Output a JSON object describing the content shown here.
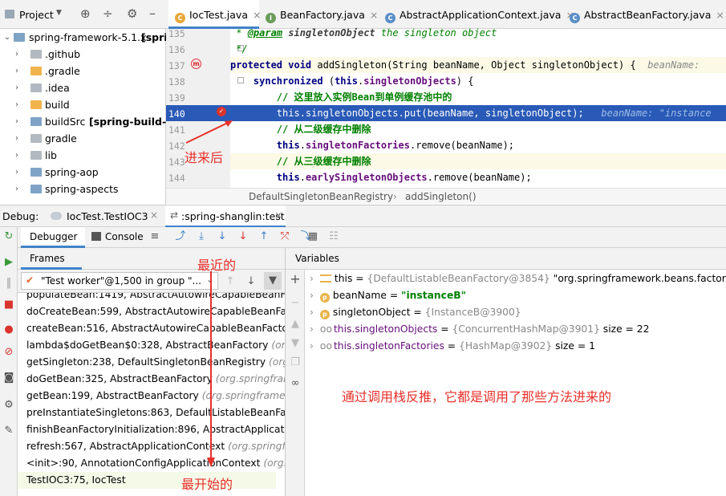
{
  "project": {
    "title": "Project",
    "root": "spring-framework-5.1.x",
    "root_module": "[spri",
    "items": [
      {
        "label": ".github",
        "module": "",
        "color": "grey"
      },
      {
        "label": ".gradle",
        "module": "",
        "color": "orange"
      },
      {
        "label": ".idea",
        "module": "",
        "color": "grey"
      },
      {
        "label": "build",
        "module": "",
        "color": "orange"
      },
      {
        "label": "buildSrc",
        "module": "[spring-build-src",
        "color": "blue"
      },
      {
        "label": "gradle",
        "module": "",
        "color": "grey"
      },
      {
        "label": "lib",
        "module": "",
        "color": "grey"
      },
      {
        "label": "spring-aop",
        "module": "",
        "color": "blue"
      },
      {
        "label": "spring-aspects",
        "module": "",
        "color": "blue"
      }
    ]
  },
  "tabs": [
    {
      "label": "IocTest.java",
      "icon": "C",
      "color": "#e8a73a",
      "active": true
    },
    {
      "label": "BeanFactory.java",
      "icon": "I",
      "color": "#6a9c5a"
    },
    {
      "label": "AbstractApplicationContext.java",
      "icon": "C",
      "color": "#5b8fc7"
    },
    {
      "label": "AbstractBeanFactory.java",
      "icon": "C",
      "color": "#5b8fc7"
    }
  ],
  "editor": {
    "lines": [
      {
        "n": "135"
      },
      {
        "n": "136"
      },
      {
        "n": "137"
      },
      {
        "n": "138"
      },
      {
        "n": "139"
      },
      {
        "n": "140"
      },
      {
        "n": "141"
      },
      {
        "n": "142"
      },
      {
        "n": "143"
      },
      {
        "n": "144"
      }
    ],
    "code": {
      "l135a": " * ",
      "l135b": "@param",
      "l135c": " singletonObject",
      "l135d": " the singleton object",
      "l136": " */",
      "l137a": "protected void ",
      "l137b": "addSingleton(String beanName, Object singletonObject) {  ",
      "l137c": "beanName: ",
      "l138a": "    synchronized ",
      "l138b": "(",
      "l138c": "this",
      "l138d": ".",
      "l138e": "singletonObjects",
      "l138f": ") {",
      "l139": "        // 这里放入实例Bean到单例缓存池中的",
      "l140a": "        this.singletonObjects.put(beanName, singletonObject);",
      "l140b": "   beanName: \"instance",
      "l141": "        // 从二级缓存中删除",
      "l142a": "        this",
      "l142b": ".",
      "l142c": "singletonFactories",
      "l142d": ".remove(beanName);",
      "l143": "        // 从三级缓存中删除",
      "l144a": "        this",
      "l144b": ".",
      "l144c": "earlySingletonObjects",
      "l144d": ".remove(beanName);"
    }
  },
  "breadcrumb": {
    "class": "DefaultSingletonBeanRegistry",
    "method": "addSingleton()"
  },
  "debug": {
    "label": "Debug:",
    "session1": "IocTest.TestIOC3",
    "session2": ":spring-shanglin:test",
    "debugger_tab": "Debugger",
    "console_tab": "Console"
  },
  "frames": {
    "title": "Frames",
    "thread": "\"Test worker\"@1,500 in group \"...",
    "items": [
      {
        "m": "populateBean:1419, AbstractAutowireCapableBeanFacto",
        "p": ""
      },
      {
        "m": "doCreateBean:599, AbstractAutowireCapableBeanFacto",
        "p": ""
      },
      {
        "m": "createBean:516, AbstractAutowireCapableBeanFactory ",
        "p": "(o"
      },
      {
        "m": "lambda$doGetBean$0:328, AbstractBeanFactory ",
        "p": "(org.sp"
      },
      {
        "m": "getSingleton:238, DefaultSingletonBeanRegistry ",
        "p": "(org.sp"
      },
      {
        "m": "doGetBean:325, AbstractBeanFactory ",
        "p": "(org.springframew"
      },
      {
        "m": "getBean:199, AbstractBeanFactory ",
        "p": "(org.springframework"
      },
      {
        "m": "preInstantiateSingletons:863, DefaultListableBeanFactor",
        "p": ""
      },
      {
        "m": "finishBeanFactoryInitialization:896, AbstractApplicationC",
        "p": ""
      },
      {
        "m": "refresh:567, AbstractApplicationContext ",
        "p": "(org.springfran"
      },
      {
        "m": "<init>:90, AnnotationConfigApplicationContext ",
        "p": "(org.spri"
      },
      {
        "m": "TestIOC3:75, IocTest",
        "p": ""
      }
    ]
  },
  "variables": {
    "title": "Variables",
    "items": [
      {
        "name": "this",
        "eq": " = ",
        "type": "{DefaultListableBeanFactory@3854}",
        "val": " \"org.springframework.beans.factory.supp"
      },
      {
        "name": "beanName",
        "eq": " = ",
        "type": "",
        "val": "\"instanceB\""
      },
      {
        "name": "singletonObject",
        "eq": " = ",
        "type": "{InstanceB@3900}",
        "val": ""
      },
      {
        "name": "this.singletonObjects",
        "eq": " = ",
        "type": "{ConcurrentHashMap@3901}",
        "val": "  size = 22"
      },
      {
        "name": "this.singletonFactories",
        "eq": " = ",
        "type": "{HashMap@3902}",
        "val": "  size = 1"
      }
    ]
  },
  "annotations": {
    "after_entry": "进来后",
    "most_recent": "最近的",
    "earliest": "最开始的",
    "explain": "通过调用栈反推，它都是调用了那些方法进来的"
  },
  "colors": {
    "accent": "#4083c9",
    "highlight": "#2a5ab7",
    "annotation": "#e8302a"
  }
}
